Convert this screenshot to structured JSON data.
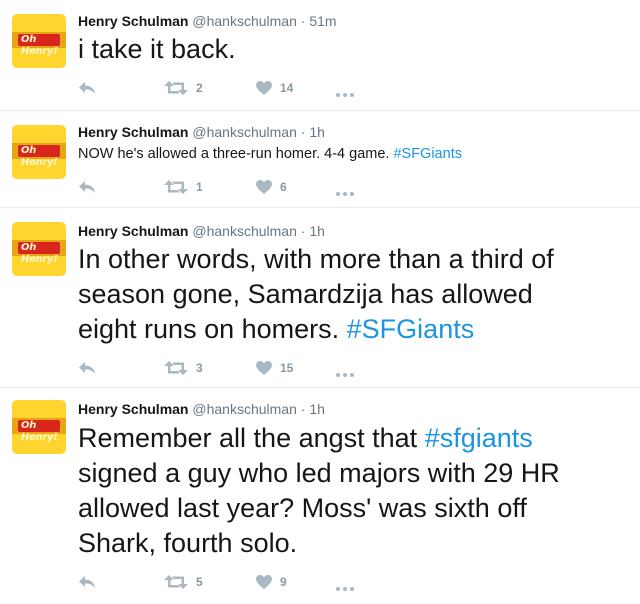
{
  "tweets": [
    {
      "author": "Henry Schulman",
      "handle": "@hankschulman",
      "separator": "·",
      "time": "51m",
      "text_plain": "i take it back.",
      "text_hashtag": "",
      "retweets": "2",
      "likes": "14"
    },
    {
      "author": "Henry Schulman",
      "handle": "@hankschulman",
      "separator": "·",
      "time": "1h",
      "text_plain": "NOW he's allowed a three-run homer. 4-4 game. ",
      "text_hashtag": "#SFGiants",
      "retweets": "1",
      "likes": "6"
    },
    {
      "author": "Henry Schulman",
      "handle": "@hankschulman",
      "separator": "·",
      "time": "1h",
      "text_plain": "In other words, with more than a third of season gone, Samardzija has allowed eight runs on homers. ",
      "text_hashtag": "#SFGiants",
      "retweets": "3",
      "likes": "15"
    },
    {
      "author": "Henry Schulman",
      "handle": "@hankschulman",
      "separator": "·",
      "time": "1h",
      "text_pre": "Remember all the angst that ",
      "text_hashtag": "#sfgiants",
      "text_post": " signed a guy who led majors with 29 HR allowed last year? Moss' was sixth off Shark, fourth solo.",
      "retweets": "5",
      "likes": "9"
    }
  ],
  "avatar_logo": "Oh Henry!",
  "icons": {
    "reply": "reply-icon",
    "retweet": "retweet-icon",
    "like": "heart-icon",
    "more": "more-icon"
  },
  "colors": {
    "hashtag": "#1b95e0",
    "meta": "#657786",
    "icon": "#aab8c2"
  }
}
